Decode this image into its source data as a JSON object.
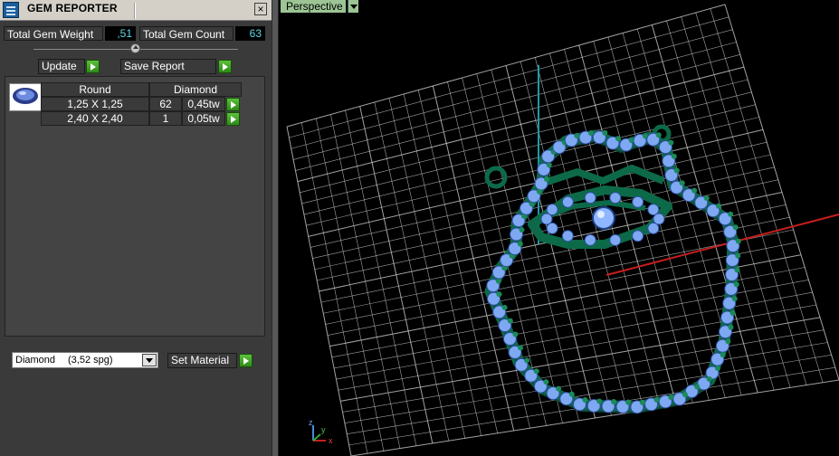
{
  "window": {
    "title": "GEM REPORTER",
    "close_label": "×"
  },
  "summary": {
    "total_weight_label": "Total Gem Weight",
    "total_weight_value": ",51",
    "total_count_label": "Total Gem Count",
    "total_count_value": "63"
  },
  "actions": {
    "update_label": "Update",
    "save_label": "Save Report"
  },
  "gem_table": {
    "headers": [
      "Round",
      "Diamond"
    ],
    "rows": [
      {
        "size": "1,25 X 1,25",
        "count": "62",
        "weight": "0,45tw"
      },
      {
        "size": "2,40 X 2,40",
        "count": "1",
        "weight": "0,05tw"
      }
    ]
  },
  "material": {
    "name": "Diamond",
    "sg": "(3,52 spg)",
    "set_label": "Set Material"
  },
  "viewport": {
    "view_name": "Perspective",
    "axis_x": "x",
    "axis_y": "y",
    "axis_z": "z"
  },
  "colors": {
    "gem": "#7fa8f2",
    "metal": "#0c6a48",
    "prong": "#1a8a5a",
    "grid": "#d8d8d8",
    "axis_red": "#c81e1e",
    "axis_cyan": "#1f9aa8"
  }
}
